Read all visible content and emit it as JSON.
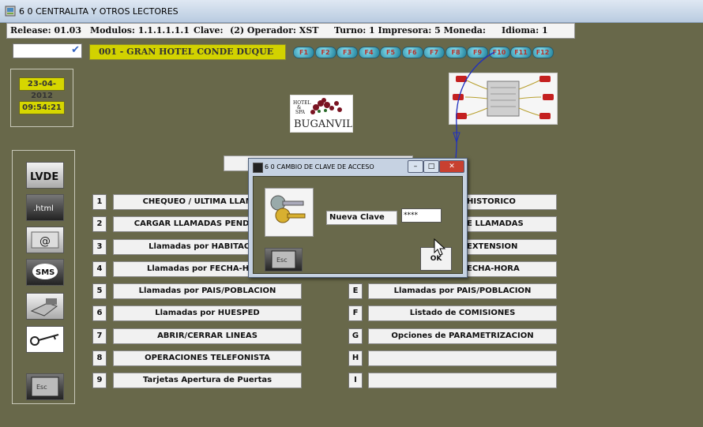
{
  "window": {
    "title": "6 0  CENTRALITA Y OTROS LECTORES"
  },
  "infobar": {
    "release": "Release: 01.03",
    "modulos": "Modulos: 1.1.1.1.1.1",
    "clave": "Clave:",
    "operador": "(2)  Operador: XST",
    "turno": "Turno:",
    "turno_val": "1  Impresora: 5  Moneda:",
    "idioma": "Idioma:  1"
  },
  "hotel_name": "001 - GRAN HOTEL CONDE DUQUE",
  "fkeys": [
    "F1",
    "F2",
    "F3",
    "F4",
    "F5",
    "F6",
    "F7",
    "F8",
    "F9",
    "F10",
    "F11",
    "F12"
  ],
  "date": "23-04-2012",
  "time": "09:54:21",
  "logo": {
    "line1": "HOTEL",
    "line2": "&",
    "line3": "SPA",
    "name": "BUGANVILIA"
  },
  "left_icons": [
    "lvde-icon",
    "html-icon",
    "email-icon",
    "sms-icon",
    "hand-icon",
    "key-icon",
    "esc-key-icon"
  ],
  "left_icon_text": {
    "lvde": "LVDE",
    "html": ".html",
    "email": "@",
    "sms": "SMS",
    "esc": "Esc"
  },
  "menu_left": [
    {
      "key": "1",
      "label": "CHEQUEO / ULTIMA LLAMADA"
    },
    {
      "key": "2",
      "label": "CARGAR LLAMADAS PENDIENTES"
    },
    {
      "key": "3",
      "label": "Llamadas por HABITACION"
    },
    {
      "key": "4",
      "label": "Llamadas por FECHA-HORA"
    },
    {
      "key": "5",
      "label": "Llamadas por PAIS/POBLACION"
    },
    {
      "key": "6",
      "label": "Llamadas por HUESPED"
    },
    {
      "key": "7",
      "label": "ABRIR/CERRAR LINEAS"
    },
    {
      "key": "8",
      "label": "OPERACIONES TELEFONISTA"
    },
    {
      "key": "9",
      "label": "Tarjetas Apertura de Puertas"
    }
  ],
  "menu_right": [
    {
      "key": "A",
      "label": "HISTORICO"
    },
    {
      "key": "B",
      "label": "E LLAMADAS"
    },
    {
      "key": "C",
      "label": "EXTENSION"
    },
    {
      "key": "D",
      "label": "ECHA-HORA"
    },
    {
      "key": "E",
      "label": "Llamadas por PAIS/POBLACION"
    },
    {
      "key": "F",
      "label": "Listado de COMISIONES"
    },
    {
      "key": "G",
      "label": "Opciones de PARAMETRIZACION"
    },
    {
      "key": "H",
      "label": ""
    },
    {
      "key": "I",
      "label": ""
    }
  ],
  "dialog": {
    "title": "6 0  CAMBIO DE CLAVE DE ACCESO",
    "field_label": "Nueva Clave",
    "field_value": "****",
    "ok_label": "OK",
    "esc_text": "Esc"
  }
}
